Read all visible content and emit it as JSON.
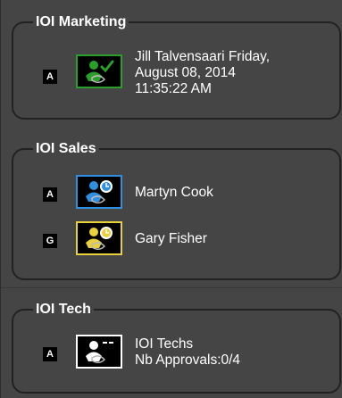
{
  "colors": {
    "background": "#454545",
    "border": "#222222",
    "approved_green": "#2aa02a",
    "pending_blue": "#2f8fe0",
    "pending_yellow": "#e8d13a",
    "waiting_white": "#ffffff"
  },
  "groups": [
    {
      "title": "IOI Marketing",
      "members": [
        {
          "badge": "A",
          "icon": "user-approved-icon",
          "status_color": "#2aa02a",
          "line1": "Jill Talvensaari Friday,",
          "line2": "August 08, 2014",
          "line3": "11:35:22 AM"
        }
      ]
    },
    {
      "title": "IOI Sales",
      "members": [
        {
          "badge": "A",
          "icon": "user-pending-icon",
          "status_color": "#2f8fe0",
          "line1": "Martyn Cook"
        },
        {
          "badge": "G",
          "icon": "user-pending-icon",
          "status_color": "#e8d13a",
          "line1": "Gary Fisher"
        }
      ]
    },
    {
      "title": "IOI Tech",
      "members": [
        {
          "badge": "A",
          "icon": "group-waiting-icon",
          "status_color": "#ffffff",
          "line1": "IOI Techs",
          "line2": "Nb Approvals:0/4"
        }
      ]
    }
  ]
}
